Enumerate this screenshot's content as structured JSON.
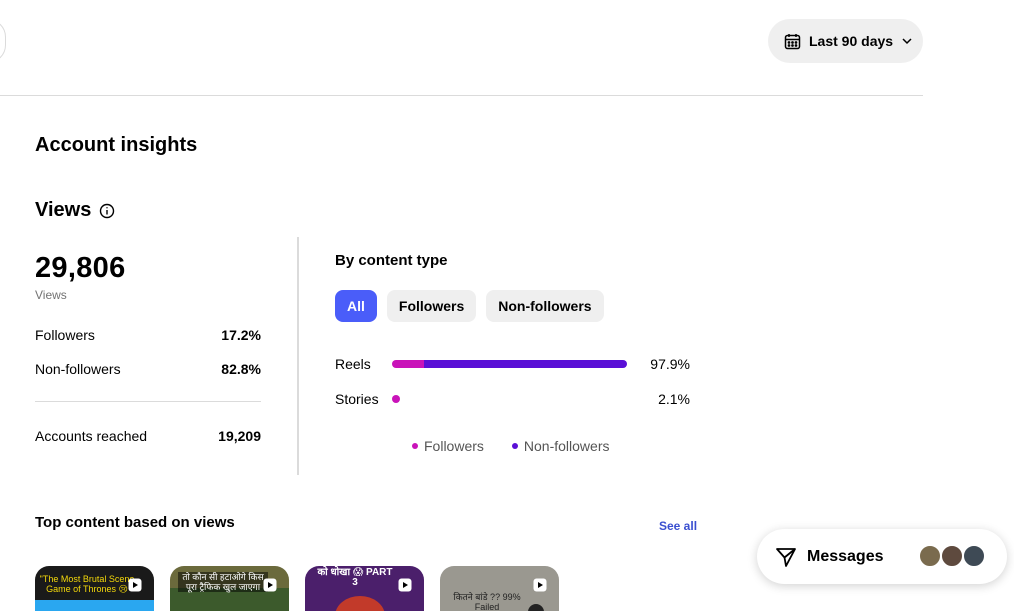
{
  "header": {
    "date_range_label": "Last 90 days"
  },
  "page": {
    "title": "Account insights"
  },
  "views": {
    "heading": "Views",
    "total": "29,806",
    "total_label": "Views",
    "stats": [
      {
        "label": "Followers",
        "value": "17.2%"
      },
      {
        "label": "Non-followers",
        "value": "82.8%"
      }
    ],
    "accounts_reached": {
      "label": "Accounts reached",
      "value": "19,209"
    }
  },
  "content_type": {
    "heading": "By content type",
    "filters": [
      {
        "label": "All",
        "active": true
      },
      {
        "label": "Followers",
        "active": false
      },
      {
        "label": "Non-followers",
        "active": false
      }
    ],
    "bars": [
      {
        "label": "Reels",
        "percent_text": "97.9%",
        "total": 97.9,
        "followers": 13.4
      },
      {
        "label": "Stories",
        "percent_text": "2.1%",
        "total": 2.1,
        "followers": 2.1
      }
    ],
    "legend": [
      {
        "label": "Followers",
        "color": "#c913b9"
      },
      {
        "label": "Non-followers",
        "color": "#5a0fd6"
      }
    ]
  },
  "top_content": {
    "heading": "Top content based on views",
    "see_all": "See all",
    "items": [
      {
        "caption": "\"The Most Brutal Scene Game of Thrones 😢",
        "bg": "#1a1a1a",
        "accent": "#2aa7f0"
      },
      {
        "caption": "तो कौन सी हटाओगे किस पूरा ट्रैफिक खुल जाएगा",
        "bg": "#6b6a3c",
        "accent": "#f0c020"
      },
      {
        "caption": "को धोखा 😱 PART 3",
        "bg": "#4b1f6b",
        "accent": "#ff4fb5"
      },
      {
        "caption": "कितने बांडे ?? 99% Failed",
        "bg": "#9a9890",
        "accent": "#222222"
      }
    ]
  },
  "messages": {
    "label": "Messages",
    "avatar_colors": [
      "#7a6b4e",
      "#5e4a3e",
      "#3e4a55"
    ]
  },
  "colors": {
    "accent_blue": "#4a5df9",
    "link_blue": "#3a4fd0",
    "followers": "#c913b9",
    "non_followers": "#5a0fd6"
  }
}
